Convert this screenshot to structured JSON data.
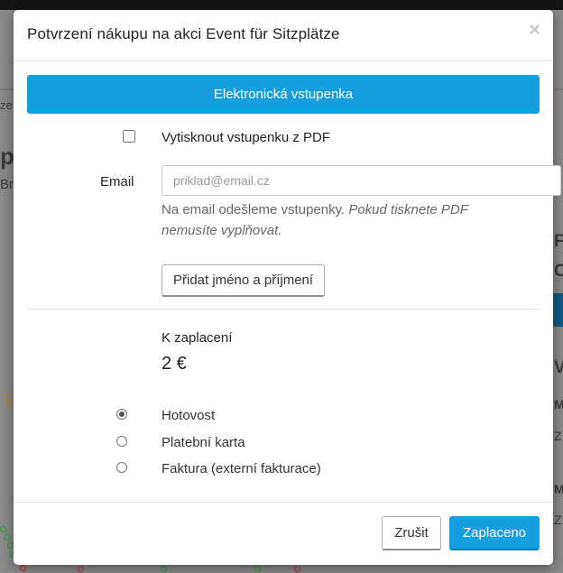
{
  "background": {
    "fragments": [
      "ze",
      "p",
      "Br",
      "F",
      "C",
      "V",
      "M",
      "Z",
      "M",
      "Z"
    ]
  },
  "modal": {
    "title": "Potvrzení nákupu na akci Event für Sitzplätze",
    "close_glyph": "×",
    "ticket_type_label": "Elektronická vstupenka",
    "print_pdf_label": "Vytisknout vstupenku z PDF",
    "email": {
      "label": "Email",
      "placeholder": "priklad@email.cz",
      "value": "",
      "help_normal": "Na email odešleme vstupenky.",
      "help_italic": "Pokud tisknete PDF nemusíte vyplňovat."
    },
    "add_name_button": "Přidat jméno a příjmení",
    "payment": {
      "label": "K zaplacení",
      "amount": "2 €",
      "methods": [
        {
          "label": "Hotovost",
          "selected": true
        },
        {
          "label": "Platební karta",
          "selected": false
        },
        {
          "label": "Faktura (externí fakturace)",
          "selected": false
        }
      ]
    },
    "buttons": {
      "cancel": "Zrušit",
      "paid": "Zaplaceno"
    }
  },
  "colors": {
    "primary": "#159ee0",
    "overlay_background": "#8a8a8a",
    "top_bar": "#141414"
  }
}
